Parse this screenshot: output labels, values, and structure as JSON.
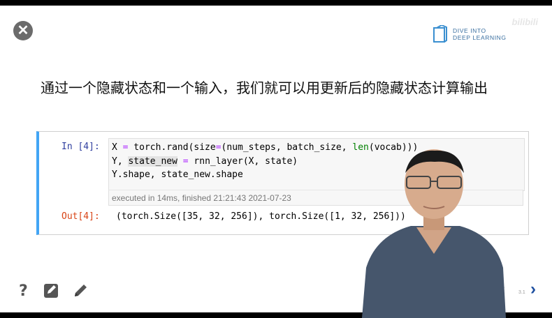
{
  "logo": {
    "line1": "DIVE INTO",
    "line2": "DEEP LEARNING"
  },
  "watermark": "bilibili",
  "slide_title": "通过一个隐藏状态和一个输入，我们就可以用更新后的隐藏状态计算输出",
  "cell": {
    "in_prompt": "In [4]:",
    "out_prompt": "Out[4]:",
    "code": {
      "l1_a": "X ",
      "l1_eq": "=",
      "l1_b": " torch.rand(size",
      "l1_eq2": "=",
      "l1_c": "(num_steps, batch_size, ",
      "l1_len": "len",
      "l1_d": "(vocab)))",
      "l2_a": "Y, ",
      "l2_hl": "state_new",
      "l2_b": " ",
      "l2_eq": "=",
      "l2_c": " rnn_layer(X, state)",
      "l3": "Y.shape, state_new.shape"
    },
    "exec_info": "executed in 14ms, finished 21:21:43 2021-07-23",
    "output": "(torch.Size([35, 32, 256]), torch.Size([1, 32, 256]))"
  },
  "slide_nav": {
    "prev": "‹",
    "number": "3.1",
    "next": "›"
  },
  "colors": {
    "accent_border": "#42a5f5",
    "in_prompt": "#303f9f",
    "out_prompt": "#d84315",
    "nav_next": "#1e4fa0"
  },
  "icons": [
    "close-icon",
    "help-icon",
    "edit-note-icon",
    "pencil-icon"
  ]
}
